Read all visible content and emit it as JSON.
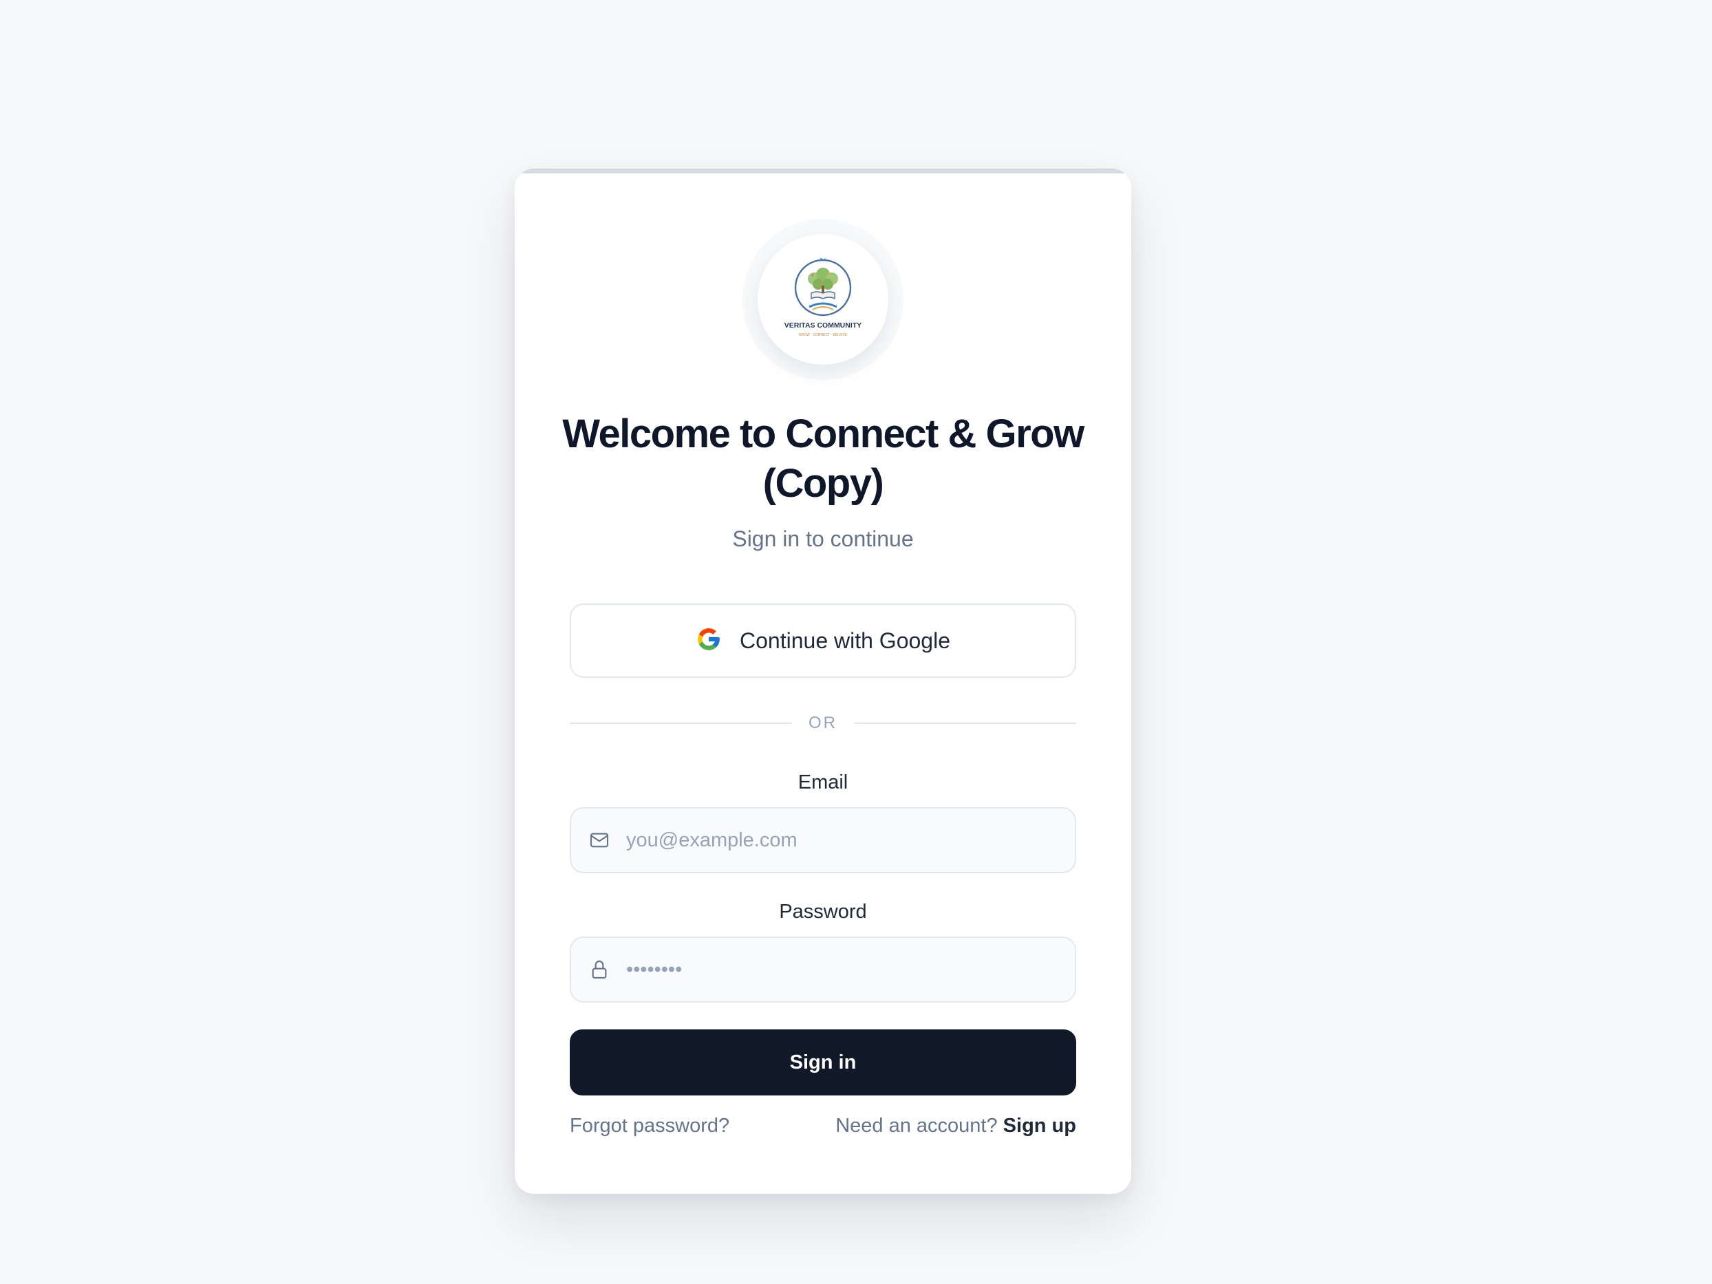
{
  "logo": {
    "org_name": "VERITAS COMMUNITY",
    "tagline": "GROW · CONNECT · BELIEVE"
  },
  "header": {
    "title": "Welcome to Connect & Grow (Copy)",
    "subtitle": "Sign in to continue"
  },
  "google": {
    "label": "Continue with Google",
    "icon": "google-g-icon"
  },
  "divider": {
    "text": "OR"
  },
  "email": {
    "label": "Email",
    "placeholder": "you@example.com",
    "icon": "mail-icon"
  },
  "password": {
    "label": "Password",
    "placeholder": "••••••••",
    "icon": "lock-icon"
  },
  "actions": {
    "sign_in_label": "Sign in",
    "forgot_label": "Forgot password?",
    "need_account_text": "Need an account?",
    "sign_up_label": "Sign up"
  },
  "colors": {
    "background": "#f6f8fa",
    "card": "#ffffff",
    "primary_button": "#111827",
    "text_heading": "#0f172a",
    "text_muted": "#64748b",
    "border": "#e2e8f0"
  }
}
